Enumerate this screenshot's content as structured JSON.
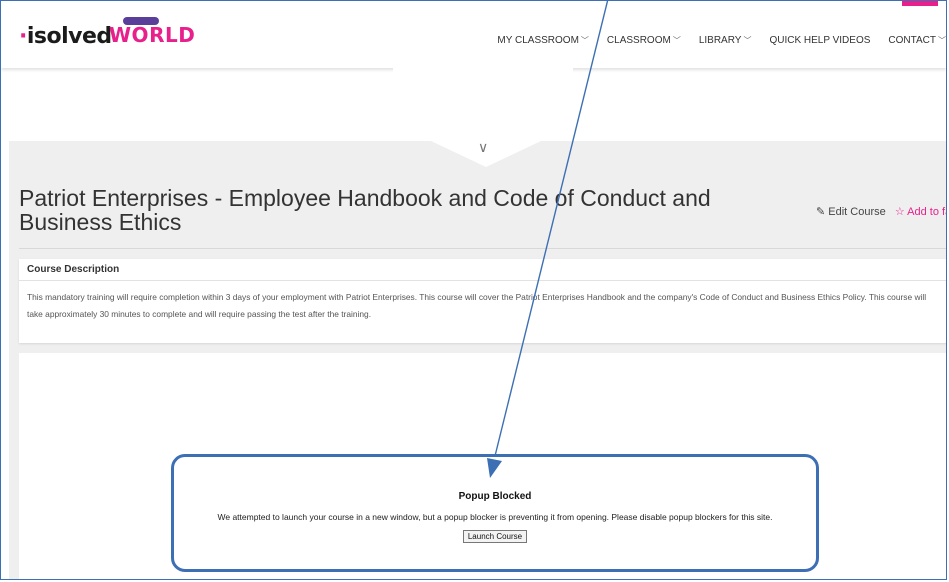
{
  "header": {
    "logo_text": "isolved",
    "logo_world_text": "WORLD",
    "nav": [
      {
        "label": "MY CLASSROOM",
        "icon": "chevron-down-icon"
      },
      {
        "label": "CLASSROOM",
        "icon": "chevron-down-icon"
      },
      {
        "label": "LIBRARY",
        "icon": "chevron-down-icon"
      },
      {
        "label": "QUICK HELP VIDEOS"
      },
      {
        "label": "CONTACT",
        "icon": "chevron-down-icon"
      }
    ]
  },
  "course": {
    "title": "Patriot Enterprises - Employee Handbook and Code of Conduct and Business Ethics",
    "edit_label": "Edit Course",
    "favorite_label": "Add to favorite"
  },
  "description": {
    "heading": "Course Description",
    "text": "This mandatory training will require completion within 3 days of your employment with Patriot Enterprises.  This course will cover the Patriot Enterprises Handbook and the company's Code of Conduct and Business Ethics Policy.  This course will take approximately 30 minutes to complete and will require passing the test after the training."
  },
  "popup": {
    "title": "Popup Blocked",
    "message": "We attempted to launch your course in a new window, but a popup blocker is preventing it from opening. Please disable popup blockers for this site.",
    "button_label": "Launch Course"
  },
  "colors": {
    "accent": "#e8208c",
    "annotation": "#3c6fb3"
  }
}
